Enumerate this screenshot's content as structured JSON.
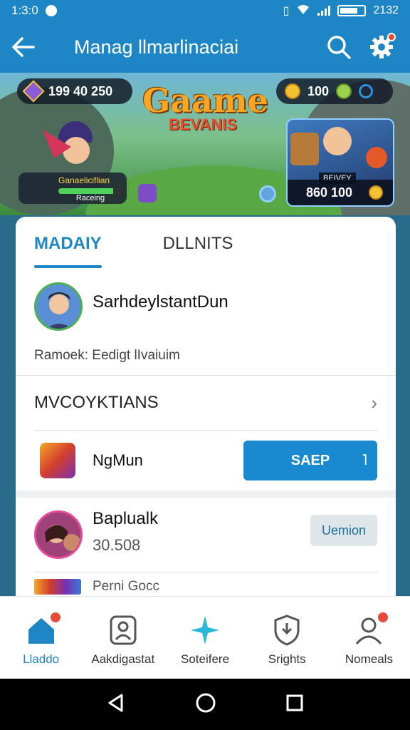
{
  "status_bar": {
    "time": "1:3:0",
    "right_text": "2132"
  },
  "app_bar": {
    "title": "Manag llmarlinaciai"
  },
  "banner": {
    "left_pill_value": "199 40 250",
    "right_pill_value": "100",
    "logo_top": "Gaame",
    "logo_bottom": "BEVANIS",
    "hero_caption": "Ganaeliciflian",
    "hero_label": "Raceing",
    "hero_progress": 0.85,
    "card_tag": "BEIVEY",
    "card_score": "860 100"
  },
  "tabs": {
    "active": "MADAIY",
    "other": "DLLNITS"
  },
  "profile": {
    "name": "SarhdeylstantDun",
    "subtitle": "Ramoek: Eedigt lIvaiuim"
  },
  "section": {
    "title": "MVCOYKTIANS"
  },
  "game_row": {
    "name": "NgMun",
    "button": "SAEP",
    "button_arrow": "˥"
  },
  "friend": {
    "name": "Baplualk",
    "number": "30.508",
    "button": "Uemion"
  },
  "mini_row": {
    "label": "Perni Gocc"
  },
  "bottom_nav": [
    {
      "label": "Lladdo",
      "icon": "home-icon"
    },
    {
      "label": "Aakdigastat",
      "icon": "profile-card-icon"
    },
    {
      "label": "Soteifere",
      "icon": "star-burst-icon"
    },
    {
      "label": "Srights",
      "icon": "shield-icon"
    },
    {
      "label": "Nomeals",
      "icon": "user-icon"
    }
  ],
  "colors": {
    "primary": "#1e86c4",
    "badge": "#e84a3a",
    "text": "#111111"
  }
}
